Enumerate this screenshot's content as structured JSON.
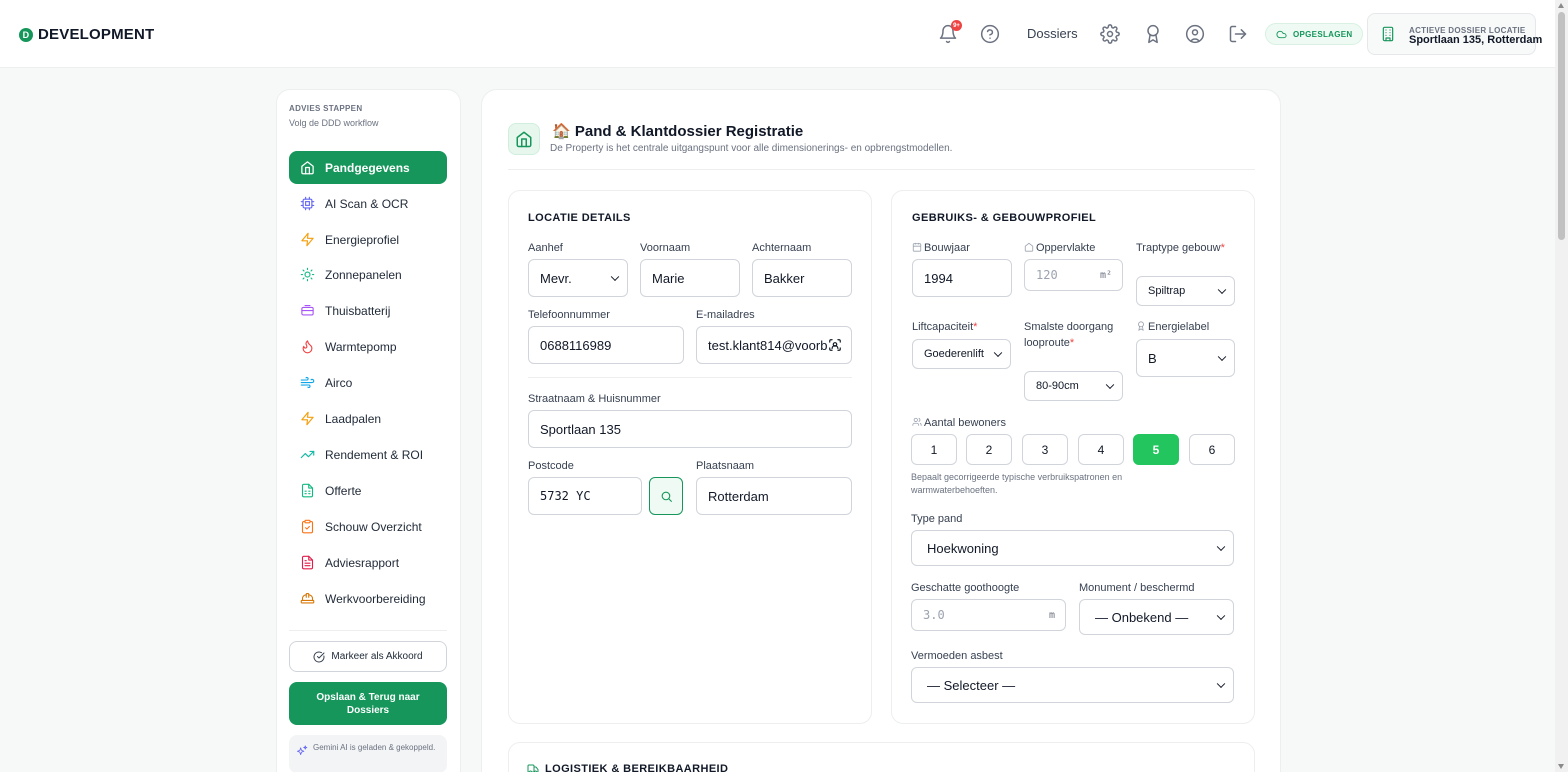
{
  "brand": {
    "initial": "D",
    "name": "DEVELOPMENT"
  },
  "header": {
    "notif_count": "9+",
    "nav_dossiers": "Dossiers",
    "saved_label": "OPGESLAGEN",
    "active_label": "ACTIEVE DOSSIER LOCATIE",
    "active_value": "Sportlaan 135, Rotterdam"
  },
  "sidebar": {
    "title": "ADVIES STAPPEN",
    "subtitle": "Volg de DDD workflow",
    "items": [
      {
        "label": "Pandgegevens",
        "icon": "home-icon",
        "color": "#ffffff"
      },
      {
        "label": "AI Scan & OCR",
        "icon": "cpu-icon",
        "color": "#6366f1"
      },
      {
        "label": "Energieprofiel",
        "icon": "bolt-icon",
        "color": "#f59e0b"
      },
      {
        "label": "Zonnepanelen",
        "icon": "sun-icon",
        "color": "#10b981"
      },
      {
        "label": "Thuisbatterij",
        "icon": "battery-icon",
        "color": "#a855f7"
      },
      {
        "label": "Warmtepomp",
        "icon": "flame-icon",
        "color": "#ef4444"
      },
      {
        "label": "Airco",
        "icon": "wind-icon",
        "color": "#0ea5e9"
      },
      {
        "label": "Laadpalen",
        "icon": "bolt-icon",
        "color": "#f59e0b"
      },
      {
        "label": "Rendement & ROI",
        "icon": "trend-icon",
        "color": "#14b8a6"
      },
      {
        "label": "Offerte",
        "icon": "document-icon",
        "color": "#10b981"
      },
      {
        "label": "Schouw Overzicht",
        "icon": "clipboard-icon",
        "color": "#f97316"
      },
      {
        "label": "Adviesrapport",
        "icon": "report-icon",
        "color": "#e11d48"
      },
      {
        "label": "Werkvoorbereiding",
        "icon": "hardhat-icon",
        "color": "#d97706"
      }
    ],
    "akkoord_label": "Markeer als Akkoord",
    "save_label": "Opslaan & Terug naar Dossiers",
    "ai_note": "Gemini AI is geladen & gekoppeld."
  },
  "page": {
    "title": "🏠 Pand & Klantdossier Registratie",
    "subtitle": "De Property is het centrale uitgangspunt voor alle dimensionerings- en opbrengstmodellen."
  },
  "location": {
    "title": "LOCATIE DETAILS",
    "aanhef_label": "Aanhef",
    "aanhef_value": "Mevr.",
    "voornaam_label": "Voornaam",
    "voornaam_value": "Marie",
    "achternaam_label": "Achternaam",
    "achternaam_value": "Bakker",
    "telefoon_label": "Telefoonnummer",
    "telefoon_value": "0688116989",
    "email_label": "E-mailadres",
    "email_value": "test.klant814@voorb",
    "straat_label": "Straatnaam & Huisnummer",
    "straat_value": "Sportlaan 135",
    "postcode_label": "Postcode",
    "postcode_value": "5732 YC",
    "plaats_label": "Plaatsnaam",
    "plaats_value": "Rotterdam"
  },
  "profile": {
    "title": "GEBRUIKS- & GEBOUWPROFIEL",
    "bouwjaar_label": "Bouwjaar",
    "bouwjaar_value": "1994",
    "oppervlakte_label": "Oppervlakte",
    "oppervlakte_placeholder": "120",
    "oppervlakte_unit": "m²",
    "traptype_label": "Traptype gebouw",
    "traptype_value": "Spiltrap",
    "lift_label": "Liftcapaciteit",
    "lift_value": "Goederenlift",
    "doorgang_label": "Smalste doorgang looproute",
    "doorgang_value": "80-90cm",
    "energielabel_label": "Energielabel",
    "energielabel_value": "B",
    "bewoners_label": "Aantal bewoners",
    "bewoners_options": [
      "1",
      "2",
      "3",
      "4",
      "5",
      "6"
    ],
    "bewoners_selected": "5",
    "bewoners_hint": "Bepaalt gecorrigeerde typische verbruikspatronen en warmwaterbehoeften.",
    "type_label": "Type pand",
    "type_value": "Hoekwoning",
    "goothoogte_label": "Geschatte goothoogte",
    "goothoogte_placeholder": "3.0",
    "goothoogte_unit": "m",
    "monument_label": "Monument / beschermd",
    "monument_value": "— Onbekend —",
    "asbest_label": "Vermoeden asbest",
    "asbest_value": "— Selecteer —"
  },
  "next_section": {
    "title": "LOGISTIEK & BEREIKBAARHEID"
  }
}
